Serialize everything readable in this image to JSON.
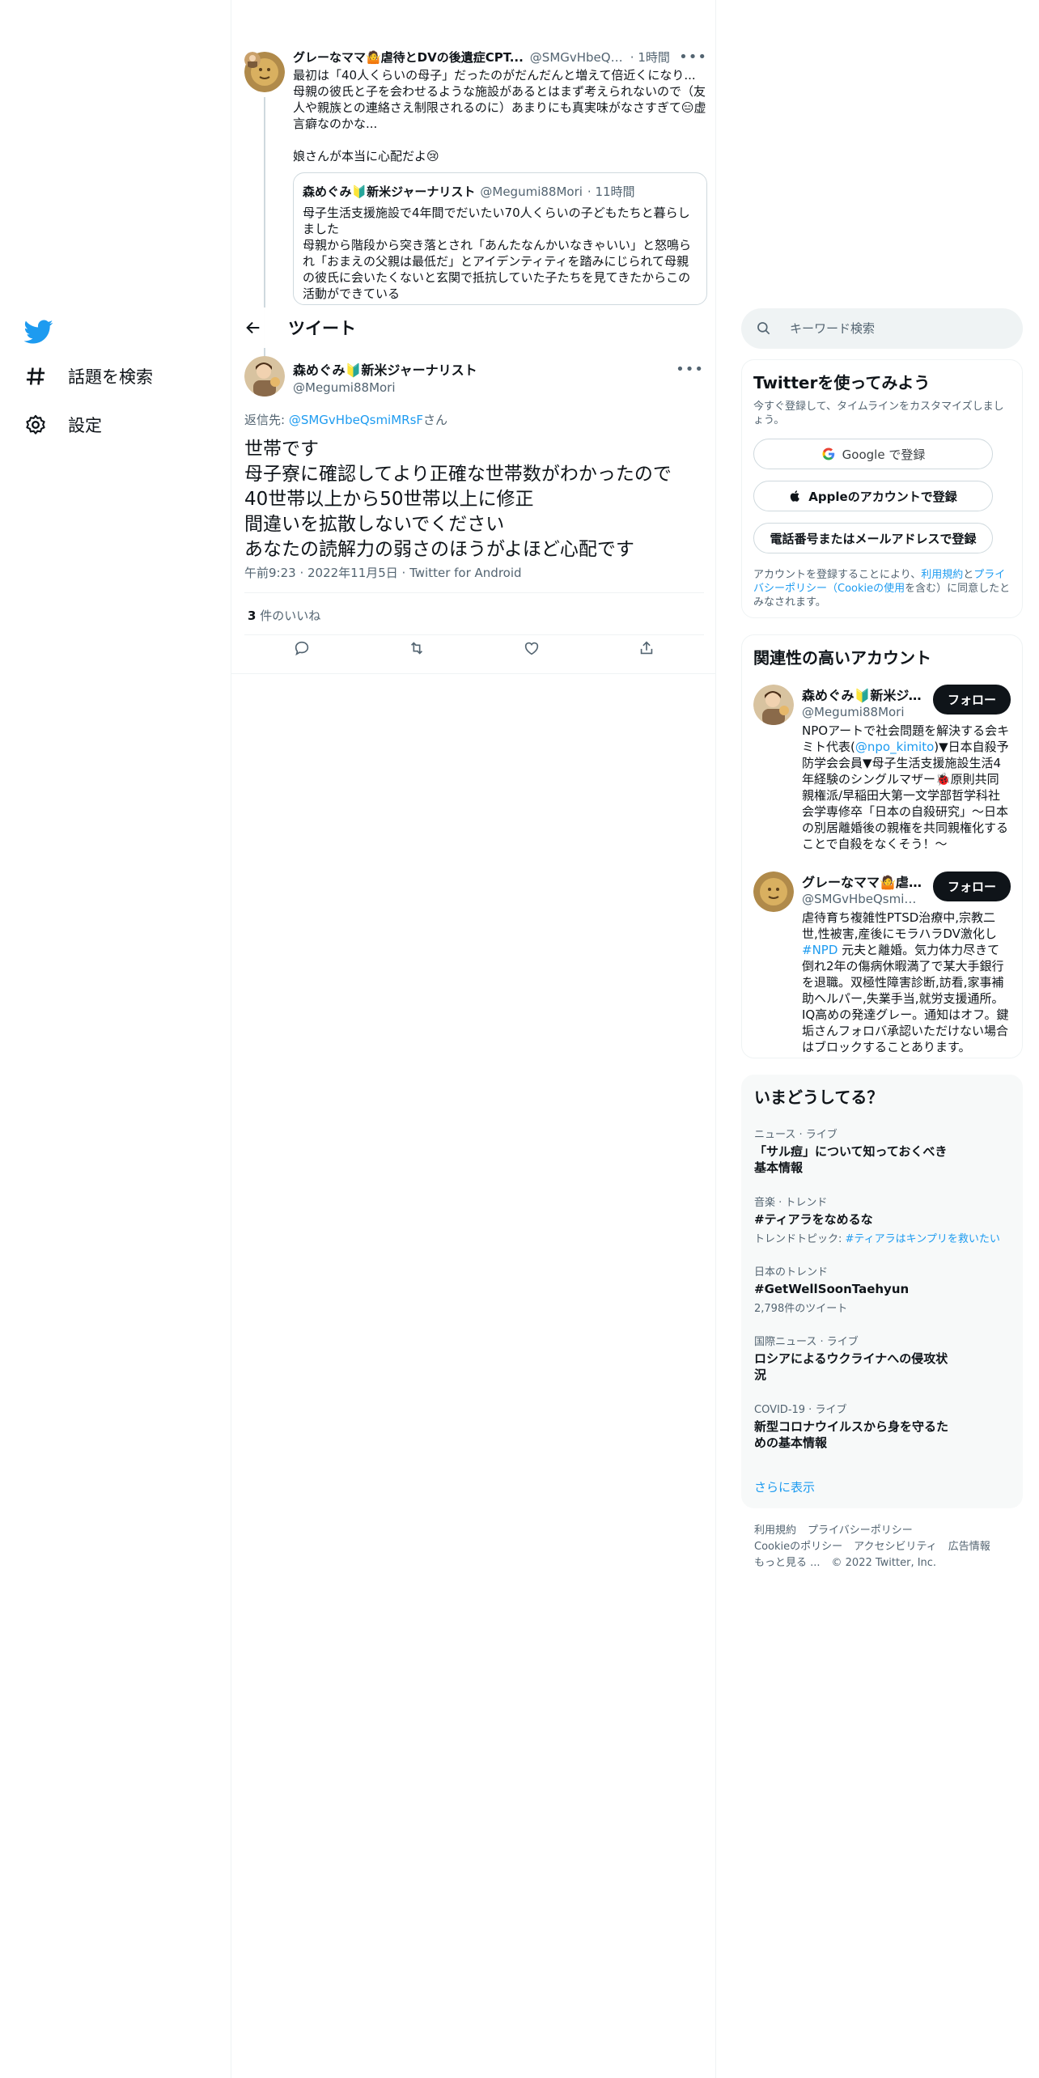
{
  "nav": {
    "items": [
      {
        "label": "話題を検索",
        "icon": "hashtag-icon"
      },
      {
        "label": "設定",
        "icon": "gear-icon"
      }
    ]
  },
  "parent_tweet": {
    "name": "グレーなママ🤷虐待とDVの後遺症CPT...",
    "handle": "@SMGvHbeQs...",
    "time": "· 1時間",
    "text": "最初は「40人くらいの母子」だったのがだんだんと増えて倍近くになり...\n母親の彼氏と子を会わせるような施設があるとはまず考えられないので（友人や親族との連絡さえ制限されるのに）あまりにも真実味がなさすぎて😑虚言癖なのかな...\n\n娘さんが本当に心配だよ😢",
    "quote": {
      "name": "森めぐみ🔰新米ジャーナリスト",
      "handle": "@Megumi88Mori",
      "time": "· 11時間",
      "text": "母子生活支援施設で4年間でだいたい70人くらいの子どもたちと暮らしました\n母親から階段から突き落とされ「あんたなんかいなきゃいい」と怒鳴られ「おまえの父親は最低だ」とアイデンティティを踏みにじられて母親の彼氏に会いたくないと玄関で抵抗していた子たちを見てきたからこの活動ができている"
    }
  },
  "header": {
    "title": "ツイート"
  },
  "main_tweet": {
    "name": "森めぐみ🔰新米ジャーナリスト",
    "handle": "@Megumi88Mori",
    "reply_prefix": "返信先: ",
    "reply_to": "@SMGvHbeQsmiMRsF",
    "reply_suffix": "さん",
    "text_lines": [
      "世帯です",
      "母子寮に確認してより正確な世帯数がわかったので",
      "40世帯以上から50世帯以上に修正",
      "間違いを拡散しないでください",
      "あなたの読解力の弱さのほうがよほど心配です"
    ],
    "timestamp": "午前9:23 · 2022年11月5日 · Twitter for Android",
    "likes_count": "3",
    "likes_label": " 件のいいね"
  },
  "search": {
    "placeholder": "キーワード検索"
  },
  "signup": {
    "title": "Twitterを使ってみよう",
    "subtitle": "今すぐ登録して、タイムラインをカスタマイズしましょう。",
    "google_label": "Google で登録",
    "apple_label": "Appleのアカウントで登録",
    "phone_label": "電話番号またはメールアドレスで登録",
    "terms_prefix": "アカウントを登録することにより、",
    "terms_link1": "利用規約",
    "terms_and": "と",
    "terms_link2": "プライバシーポリシー（Cookieの使用",
    "terms_suffix": "を含む）に同意したとみなされます。"
  },
  "related": {
    "title": "関連性の高いアカウント",
    "follow_label": "フォロー",
    "accounts": [
      {
        "name": "森めぐみ🔰新米ジャ...",
        "handle": "@Megumi88Mori",
        "bio_pre": "NPOアートで社会問題を解決する会キミト代表(",
        "bio_link": "@npo_kimito",
        "bio_post": ")▼日本自殺予防学会会員▼母子生活支援施設生活4年経験のシングルマザー🐞原則共同親権派/早稲田大第一文学部哲学科社会学専修卒「日本の自殺研究」～日本の別居離婚後の親権を共同親権化することで自殺をなくそう！～"
      },
      {
        "name": "グレーなママ🤷虐待...",
        "handle": "@SMGvHbeQsmiMR...",
        "bio_pre": "虐待育ち複雑性PTSD治療中,宗教二世,性被害,産後にモラハラDV激化し",
        "bio_link": "#NPD",
        "bio_post": " 元夫と離婚。気力体力尽きて倒れ2年の傷病休暇満了で某大手銀行を退職。双極性障害診断,訪看,家事補助ヘルパー,失業手当,就労支援通所。IQ高めの発達グレー。通知はオフ。鍵垢さんフォロバ承認いただけない場合はブロックすることあります。"
      }
    ]
  },
  "trends": {
    "title": "いまどうしてる？",
    "items": [
      {
        "category": "ニュース · ライブ",
        "title": "「サル痘」について知っておくべき基本情報",
        "sub": "",
        "sub_link": ""
      },
      {
        "category": "音楽 · トレンド",
        "title": "#ティアラをなめるな",
        "sub": "トレンドトピック: ",
        "sub_link": "#ティアラはキンプリを救いたい"
      },
      {
        "category": "日本のトレンド",
        "title": "#GetWellSoonTaehyun",
        "sub": "2,798件のツイート",
        "sub_link": ""
      },
      {
        "category": "国際ニュース · ライブ",
        "title": "ロシアによるウクライナへの侵攻状況",
        "sub": "",
        "sub_link": ""
      },
      {
        "category": "COVID-19 · ライブ",
        "title": "新型コロナウイルスから身を守るための基本情報",
        "sub": "",
        "sub_link": ""
      }
    ],
    "show_more": "さらに表示"
  },
  "footer": {
    "links": [
      "利用規約",
      "プライバシーポリシー",
      "Cookieのポリシー",
      "アクセシビリティ",
      "広告情報",
      "もっと見る ..."
    ],
    "copyright": "© 2022 Twitter, Inc."
  },
  "colors": {
    "accent": "#1d9bf0",
    "text": "#0f1419",
    "secondary": "#536471"
  }
}
